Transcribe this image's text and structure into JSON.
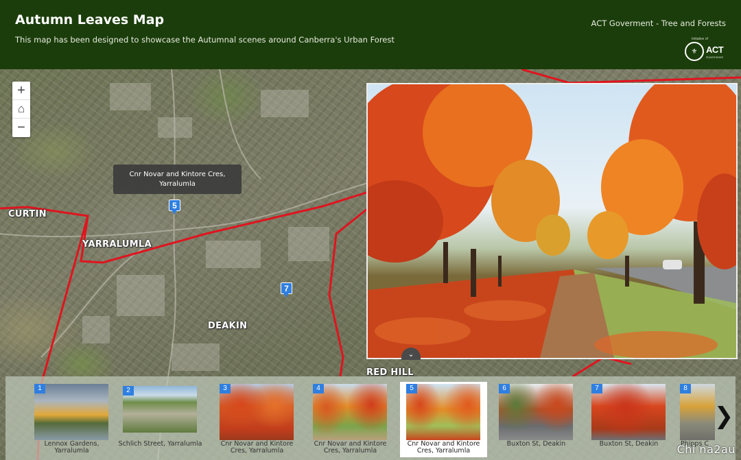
{
  "header": {
    "title": "Autumn Leaves Map",
    "subtitle": "This map has been designed to showcase the Autumnal scenes around Canberra's Urban Forest",
    "org": "ACT Goverment - Tree and Forests",
    "logo_initiative": "Initiative of",
    "logo_word": "ACT",
    "logo_gov": "Government"
  },
  "map": {
    "zoom_in": "+",
    "home": "⌂",
    "zoom_out": "−",
    "suburbs": [
      "CURTIN",
      "YARRALUMLA",
      "DEAKIN",
      "RED HILL"
    ],
    "tooltip": "Cnr Novar and Kintore Cres, Yarralumla",
    "pins": [
      "5",
      "7"
    ],
    "collapse_icon": "⌄"
  },
  "carousel": {
    "items": [
      {
        "num": "1",
        "caption": "Lennox Gardens, Yarralumla"
      },
      {
        "num": "2",
        "caption": "Schlich Street, Yarralumla"
      },
      {
        "num": "3",
        "caption": "Cnr Novar and Kintore Cres, Yarralumla"
      },
      {
        "num": "4",
        "caption": "Cnr Novar and Kintore Cres, Yarralumla"
      },
      {
        "num": "5",
        "caption": "Cnr Novar and Kintore Cres, Yarralumla"
      },
      {
        "num": "6",
        "caption": "Buxton St, Deakin"
      },
      {
        "num": "7",
        "caption": "Buxton St, Deakin"
      },
      {
        "num": "8",
        "caption": "Phipps C"
      }
    ],
    "active_index": 4,
    "next_icon": "❯"
  },
  "watermark": "Chi na2au",
  "colors": {
    "header_bg": "#1b3d0b",
    "pin": "#2f7fe0",
    "boundary": "#e0141e"
  }
}
